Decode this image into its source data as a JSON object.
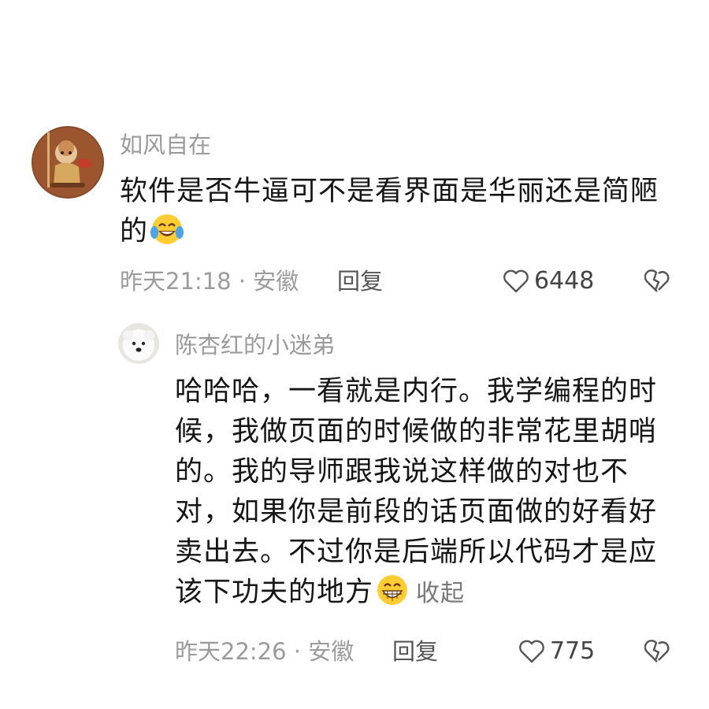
{
  "comments": [
    {
      "username": "如风自在",
      "text": "软件是否牛逼可不是看界面是华丽还是简陋的",
      "emoji": "laughing-crying-emoji",
      "time_location": "昨天21:18 · 安徽",
      "reply_label": "回复",
      "likes": "6448",
      "avatar_icon": "monkey-king-avatar"
    }
  ],
  "replies": [
    {
      "username": "陈杏红的小迷弟",
      "text": "哈哈哈，一看就是内行。我学编程的时候，我做页面的时候做的非常花里胡哨的。我的导师跟我说这样做的对也不对，如果你是前段的话页面做的好看好卖出去。不过你是后端所以代码才是应该下功夫的地方",
      "emoji": "grinning-emoji",
      "collapse_label": "收起",
      "time_location": "昨天22:26 · 安徽",
      "reply_label": "回复",
      "likes": "775",
      "avatar_icon": "white-dog-avatar"
    }
  ],
  "colors": {
    "meta_gray": "#9b9b9b",
    "text": "#151515"
  }
}
